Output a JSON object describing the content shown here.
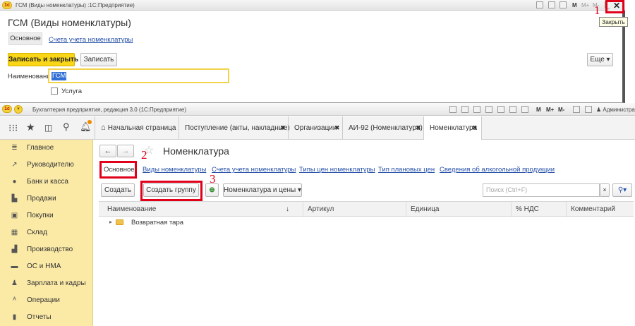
{
  "window1": {
    "titlebar_text": "ГСМ (Виды номенклатуры) :1С:Предприятие)",
    "title": "ГСМ (Виды номенклатуры)",
    "tabs": [
      "Основное",
      "Счета учета номенклатуры"
    ],
    "save_close_label": "Записать и закрыть",
    "save_label": "Записать",
    "more_label": "Еще ▾",
    "name_label": "Наименование:",
    "name_value": "ГСМ",
    "service_label": "Услуга",
    "close_tooltip": "Закрыть",
    "tb_icons": [
      "M",
      "M+",
      "M-"
    ]
  },
  "window2": {
    "titlebar_text": "Бухгалтерия предприятия, редакция 3.0  (1С:Предприятие)",
    "user_label": "Администрат",
    "tb_icons": [
      "M",
      "M+",
      "M-"
    ],
    "tabs": [
      {
        "label": "Начальная страница",
        "closable": false
      },
      {
        "label": "Поступление (акты, накладные)",
        "closable": true
      },
      {
        "label": "Организации",
        "closable": true
      },
      {
        "label": "АИ-92 (Номенклатура)",
        "closable": true
      },
      {
        "label": "Номенклатура",
        "closable": true
      }
    ],
    "sidebar": [
      {
        "label": "Главное",
        "icon": "≣"
      },
      {
        "label": "Руководителю",
        "icon": "↗"
      },
      {
        "label": "Банк и касса",
        "icon": "●"
      },
      {
        "label": "Продажи",
        "icon": "▙"
      },
      {
        "label": "Покупки",
        "icon": "▣"
      },
      {
        "label": "Склад",
        "icon": "▦"
      },
      {
        "label": "Производство",
        "icon": "▟"
      },
      {
        "label": "ОС и НМА",
        "icon": "▬"
      },
      {
        "label": "Зарплата и кадры",
        "icon": "♟"
      },
      {
        "label": "Операции",
        "icon": "ᴬ"
      },
      {
        "label": "Отчеты",
        "icon": "▮"
      }
    ],
    "page_title": "Номенклатура",
    "nav_links": [
      "Основное",
      "Виды номенклатуры",
      "Счета учета номенклатуры",
      "Типы цен номенклатуры",
      "Тип плановых цен",
      "Сведения об алкогольной продукции"
    ],
    "create_label": "Создать",
    "create_group_label": "Создать группу",
    "nomen_prices_label": "Номенклатура и цены ▾",
    "search_placeholder": "Поиск (Ctrl+F)",
    "columns": [
      "Наименование",
      "↓",
      "Артикул",
      "Единица",
      "% НДС",
      "Комментарий"
    ],
    "rows": [
      {
        "name": "Возвратная тара"
      }
    ]
  },
  "annotations": {
    "n1": "1",
    "n2": "2",
    "n3": "3"
  },
  "colors": {
    "accent_yellow": "#f9d617",
    "sidebar_bg": "#fbeaa6",
    "annotation_red": "#e0001a",
    "link_blue": "#2550a8"
  }
}
